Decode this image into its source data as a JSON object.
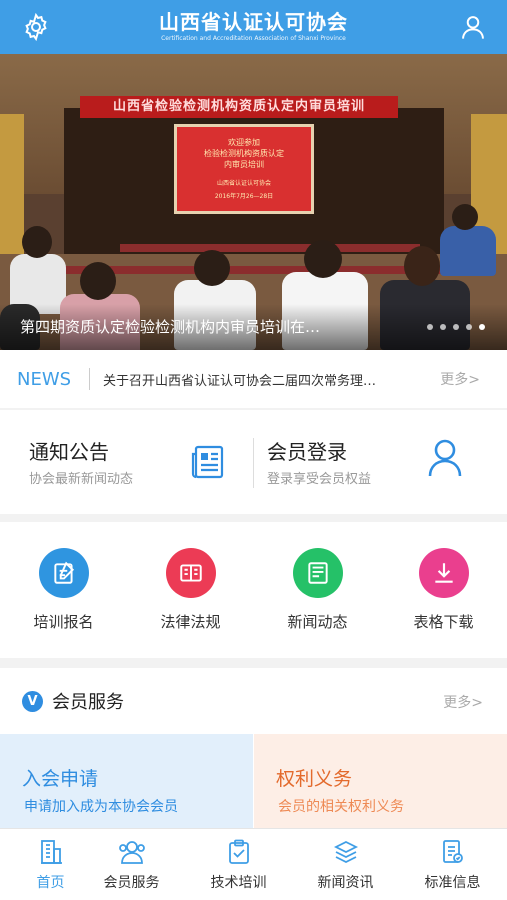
{
  "header": {
    "title": "山西省认证认可协会",
    "subtitle": "Certification and Accreditation Association of Shanxi Province"
  },
  "banner": {
    "strip_text": "山西省检验检测机构资质认定内审员培训",
    "screen_line1": "欢迎参加",
    "screen_line2": "检验检测机构资质认定",
    "screen_line3": "内审员培训",
    "screen_org": "山西省认证认可协会",
    "screen_date": "2016年7月26—28日",
    "caption": "第四期资质认定检验检测机构内审员培训在…",
    "slide_count": 5,
    "active_slide": 5
  },
  "news": {
    "tag": "NEWS",
    "headline": "关于召开山西省认证认可协会二届四次常务理…",
    "more": "更多>"
  },
  "quick_links": [
    {
      "title": "通知公告",
      "subtitle": "协会最新新闻动态",
      "icon": "newspaper-icon"
    },
    {
      "title": "会员登录",
      "subtitle": "登录享受会员权益",
      "icon": "user-icon"
    }
  ],
  "categories": [
    {
      "label": "培训报名",
      "icon": "edit-form-icon",
      "color": "#2f95e0"
    },
    {
      "label": "法律法规",
      "icon": "law-book-icon",
      "color": "#ec3b55"
    },
    {
      "label": "新闻动态",
      "icon": "news-icon",
      "color": "#25c168"
    },
    {
      "label": "表格下载",
      "icon": "download-icon",
      "color": "#ea3f8e"
    }
  ],
  "member_services": {
    "badge": "V",
    "title": "会员服务",
    "more": "更多>",
    "cards": [
      {
        "title": "入会申请",
        "subtitle": "申请加入成为本协会会员"
      },
      {
        "title": "权利义务",
        "subtitle": "会员的相关权利义务"
      }
    ]
  },
  "tabbar": [
    {
      "label": "首页",
      "icon": "building-icon",
      "active": true
    },
    {
      "label": "会员服务",
      "icon": "members-icon",
      "active": false
    },
    {
      "label": "技术培训",
      "icon": "clipboard-icon",
      "active": false
    },
    {
      "label": "新闻资讯",
      "icon": "layers-icon",
      "active": false
    },
    {
      "label": "标准信息",
      "icon": "document-icon",
      "active": false
    }
  ],
  "colors": {
    "primary": "#3f9ee6",
    "member_card_blue": "#e2effb",
    "member_card_orange": "#fdeee6"
  }
}
